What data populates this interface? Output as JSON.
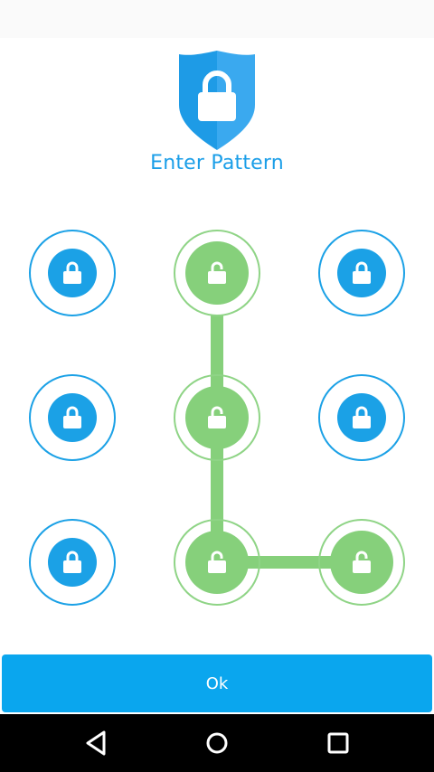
{
  "header": {
    "icon": "shield-lock-icon",
    "title": "Enter Pattern"
  },
  "pattern": {
    "dot_icon_locked": "lock-icon",
    "dot_icon_unlocked": "unlock-icon",
    "colors": {
      "inactive": "#1ba1e6",
      "active": "#86d07b",
      "active_ring": "#8fd486"
    },
    "selected_sequence": [
      2,
      5,
      8,
      9
    ]
  },
  "actions": {
    "ok_label": "Ok",
    "ok_color": "#0aa6ee"
  },
  "navbar": {
    "back_icon": "back-triangle-icon",
    "home_icon": "home-circle-icon",
    "recent_icon": "recent-square-icon"
  }
}
